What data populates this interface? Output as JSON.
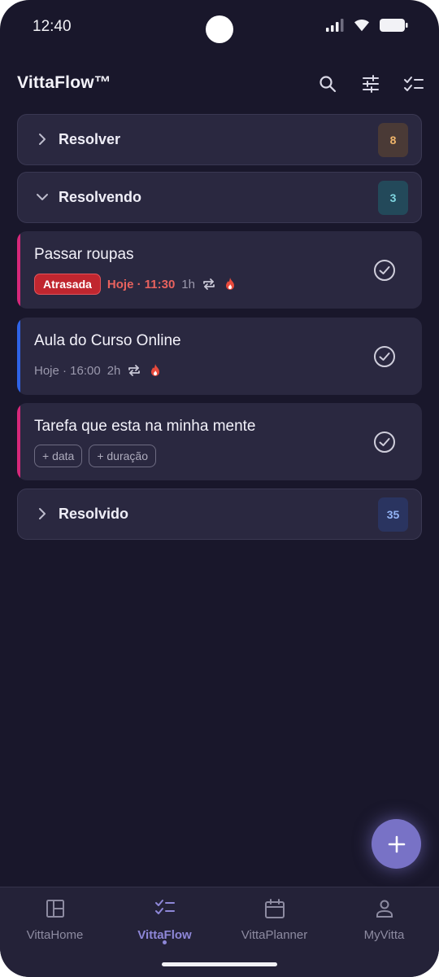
{
  "status_bar": {
    "time": "12:40"
  },
  "app": {
    "title": "VittaFlow™",
    "icons": [
      "search-icon",
      "tune-icon",
      "checklist-icon"
    ]
  },
  "sections": {
    "resolver": {
      "label": "Resolver",
      "count": "8",
      "expanded": false,
      "badge_bg": "#4a3a36",
      "badge_fg": "#f0b56b"
    },
    "resolvendo": {
      "label": "Resolvendo",
      "count": "3",
      "expanded": true,
      "badge_bg": "#23495a",
      "badge_fg": "#7fd6e0"
    },
    "resolvido": {
      "label": "Resolvido",
      "count": "35",
      "expanded": false,
      "badge_bg": "#2a3460",
      "badge_fg": "#93b3f5"
    }
  },
  "tasks": [
    {
      "title": "Passar roupas",
      "status_pill": "Atrasada",
      "due": "Hoje · 11:30",
      "duration": "1h",
      "accent": "#d6287a",
      "icons": [
        "repeat-icon",
        "fire-icon"
      ]
    },
    {
      "title": "Aula do Curso Online",
      "due": "Hoje · 16:00",
      "duration": "2h",
      "accent": "#2f63e6",
      "icons": [
        "repeat-icon",
        "fire-icon"
      ]
    },
    {
      "title": "Tarefa que esta na minha mente",
      "chips": [
        "+ data",
        "+ duração"
      ],
      "accent": "#d6287a"
    }
  ],
  "fab": {
    "icon": "plus-icon"
  },
  "bottom_nav": [
    {
      "label": "VittaHome",
      "icon": "dashboard-icon",
      "active": false
    },
    {
      "label": "VittaFlow",
      "icon": "checklist-icon",
      "active": true
    },
    {
      "label": "VittaPlanner",
      "icon": "calendar-icon",
      "active": false
    },
    {
      "label": "MyVitta",
      "icon": "person-icon",
      "active": false
    }
  ]
}
